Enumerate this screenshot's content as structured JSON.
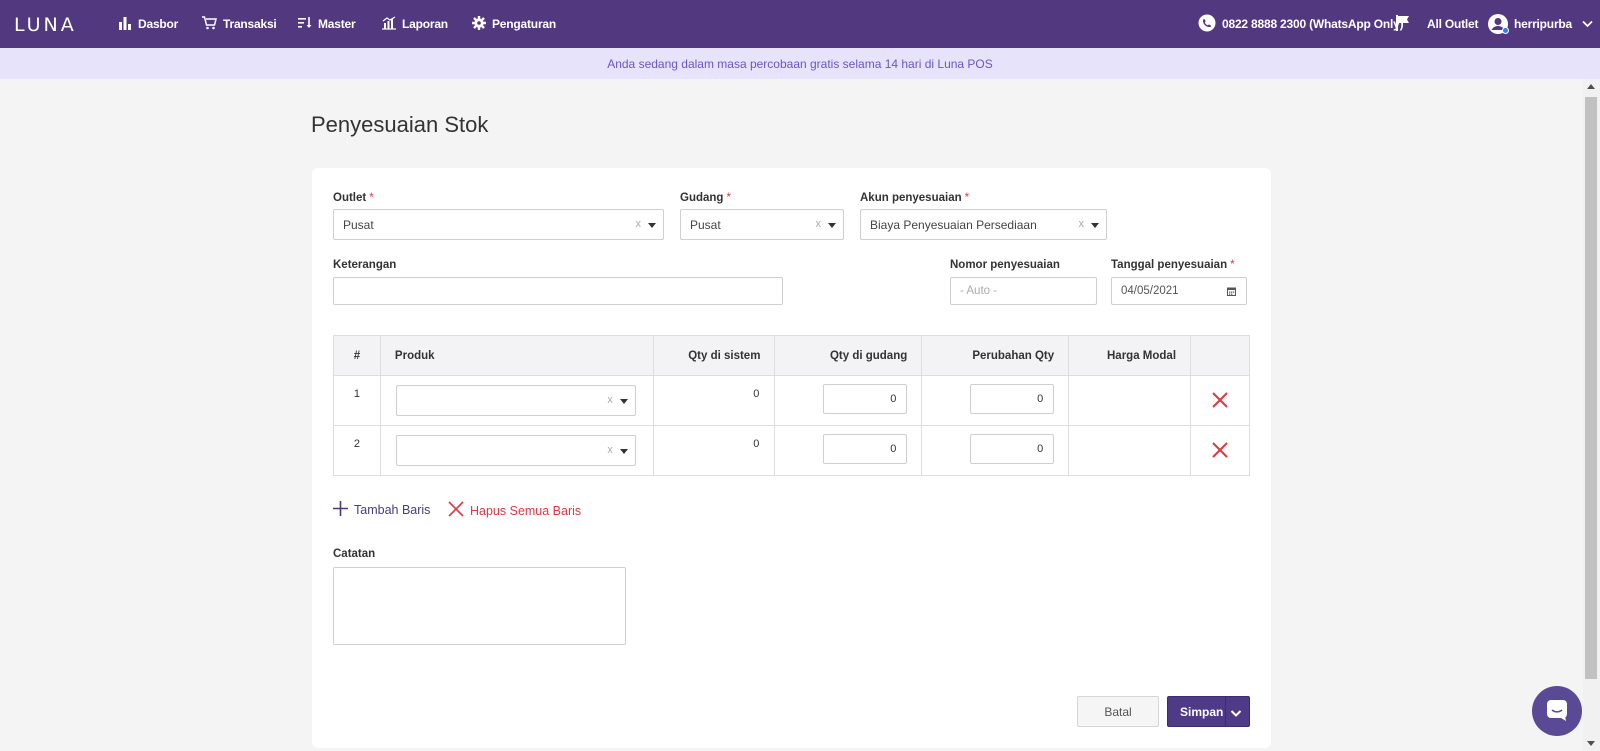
{
  "nav": {
    "logo": "LUNA",
    "items": [
      {
        "label": "Dasbor",
        "icon": "bar-chart-icon"
      },
      {
        "label": "Transaksi",
        "icon": "cart-icon"
      },
      {
        "label": "Master",
        "icon": "sort-icon"
      },
      {
        "label": "Laporan",
        "icon": "report-chart-icon"
      },
      {
        "label": "Pengaturan",
        "icon": "gear-icon"
      }
    ],
    "phone": "0822 8888 2300 (WhatsApp Only)",
    "outlet": "All Outlet",
    "user": "herripurba"
  },
  "trial_banner": "Anda sedang dalam masa percobaan gratis selama 14 hari di Luna POS",
  "page_title": "Penyesuaian Stok",
  "form": {
    "outlet_label": "Outlet",
    "outlet_value": "Pusat",
    "gudang_label": "Gudang",
    "gudang_value": "Pusat",
    "akun_label": "Akun penyesuaian",
    "akun_value": "Biaya Penyesuaian Persediaan",
    "keterangan_label": "Keterangan",
    "keterangan_value": "",
    "nomor_label": "Nomor penyesuaian",
    "nomor_placeholder": "- Auto -",
    "tanggal_label": "Tanggal penyesuaian",
    "tanggal_value": "04/05/2021",
    "required_mark": "*",
    "clear_mark": "x"
  },
  "table": {
    "headers": [
      "#",
      "Produk",
      "Qty di sistem",
      "Qty di gudang",
      "Perubahan Qty",
      "Harga Modal",
      ""
    ],
    "rows": [
      {
        "no": "1",
        "produk": "",
        "qty_sistem": "0",
        "qty_gudang": "0",
        "perubahan": "0",
        "harga": ""
      },
      {
        "no": "2",
        "produk": "",
        "qty_sistem": "0",
        "qty_gudang": "0",
        "perubahan": "0",
        "harga": ""
      }
    ]
  },
  "actions": {
    "add_row": "Tambah Baris",
    "delete_all": "Hapus Semua Baris"
  },
  "catatan_label": "Catatan",
  "buttons": {
    "cancel": "Batal",
    "save": "Simpan"
  },
  "colors": {
    "primary": "#52387e",
    "danger": "#e0373f",
    "banner_bg": "#e6e3fa"
  }
}
